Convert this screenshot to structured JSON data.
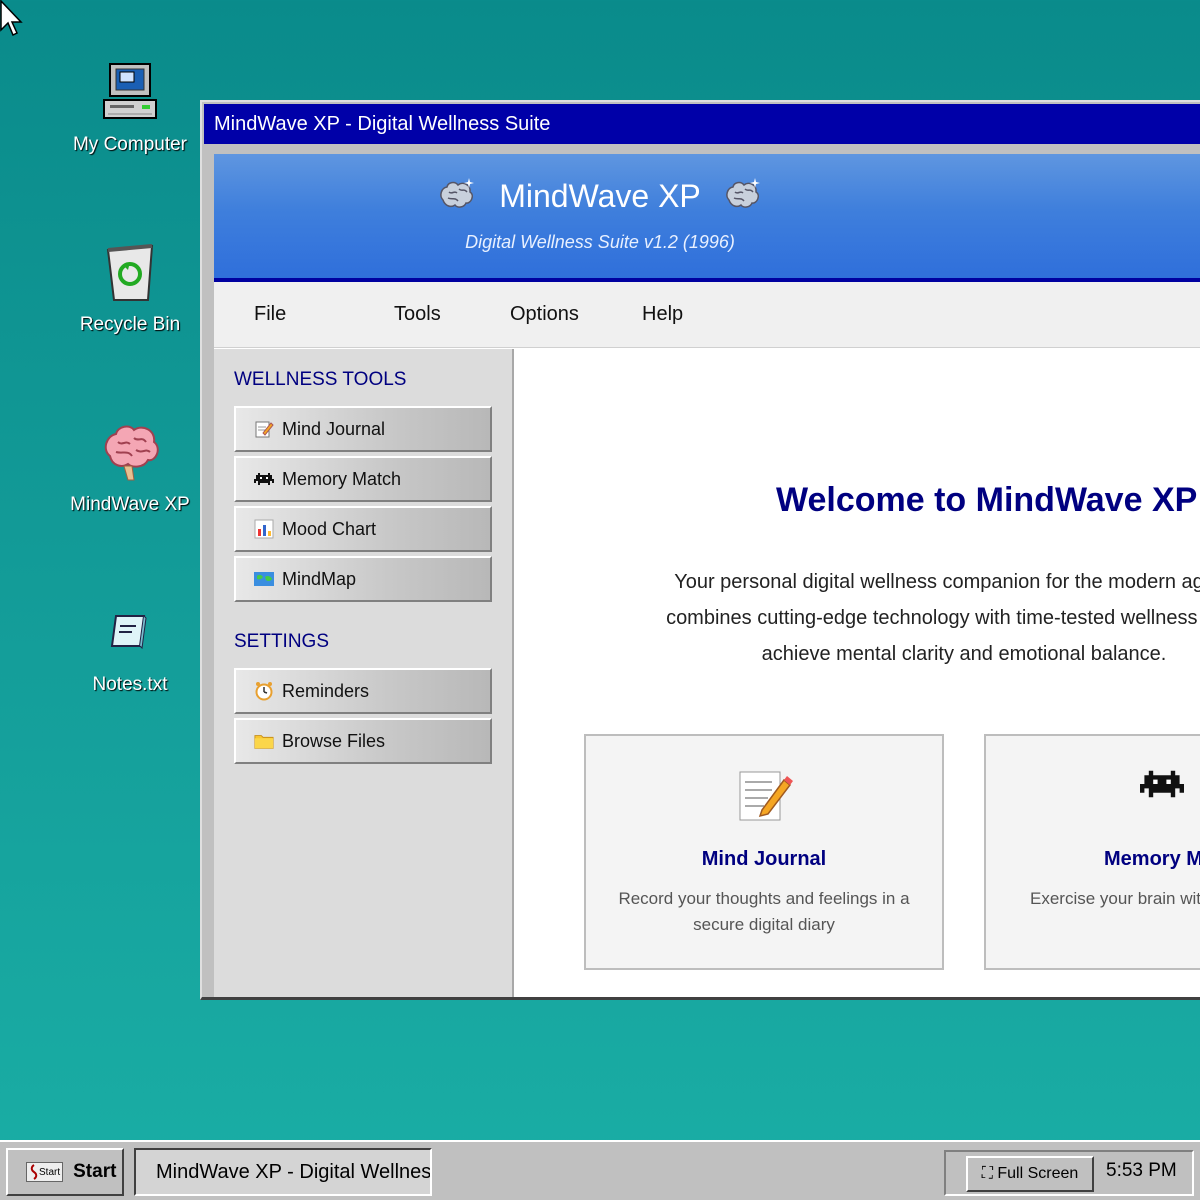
{
  "desktop": {
    "icons": [
      {
        "label": "My Computer",
        "icon": "computer-icon"
      },
      {
        "label": "Recycle Bin",
        "icon": "recycle-bin-icon"
      },
      {
        "label": "MindWave XP",
        "icon": "brain-icon"
      },
      {
        "label": "Notes.txt",
        "icon": "notepad-icon"
      }
    ]
  },
  "window": {
    "title": "MindWave XP - Digital Wellness Suite",
    "banner": {
      "title": "MindWave XP",
      "subtitle": "Digital Wellness Suite v1.2 (1996)"
    },
    "menu": [
      "File",
      "Tools",
      "Options",
      "Help"
    ],
    "sidebar": {
      "wellness_heading": "WELLNESS TOOLS",
      "wellness_items": [
        {
          "label": "Mind Journal",
          "icon": "pencil-memo-icon"
        },
        {
          "label": "Memory Match",
          "icon": "space-invader-icon"
        },
        {
          "label": "Mood Chart",
          "icon": "bar-chart-icon"
        },
        {
          "label": "MindMap",
          "icon": "world-map-icon"
        }
      ],
      "settings_heading": "SETTINGS",
      "settings_items": [
        {
          "label": "Reminders",
          "icon": "alarm-clock-icon"
        },
        {
          "label": "Browse Files",
          "icon": "folder-icon"
        }
      ]
    },
    "main": {
      "welcome": "Welcome to MindWave XP",
      "intro_lines": [
        "Your personal digital wellness companion for the modern age. Mir",
        "combines cutting-edge technology with time-tested wellness practic",
        "achieve mental clarity and emotional balance."
      ],
      "cards": [
        {
          "title": "Mind Journal",
          "desc": "Record your thoughts and feelings in a secure digital diary",
          "icon": "pencil-memo-icon"
        },
        {
          "title": "Memory Mat",
          "desc": "Exercise your brain with challenges",
          "icon": "space-invader-icon"
        }
      ]
    }
  },
  "taskbar": {
    "start_label": "Start",
    "start_logo_text": "Start",
    "task_label": "MindWave XP - Digital Wellness",
    "fullscreen_label": "Full Screen",
    "clock": "5:53 PM"
  }
}
